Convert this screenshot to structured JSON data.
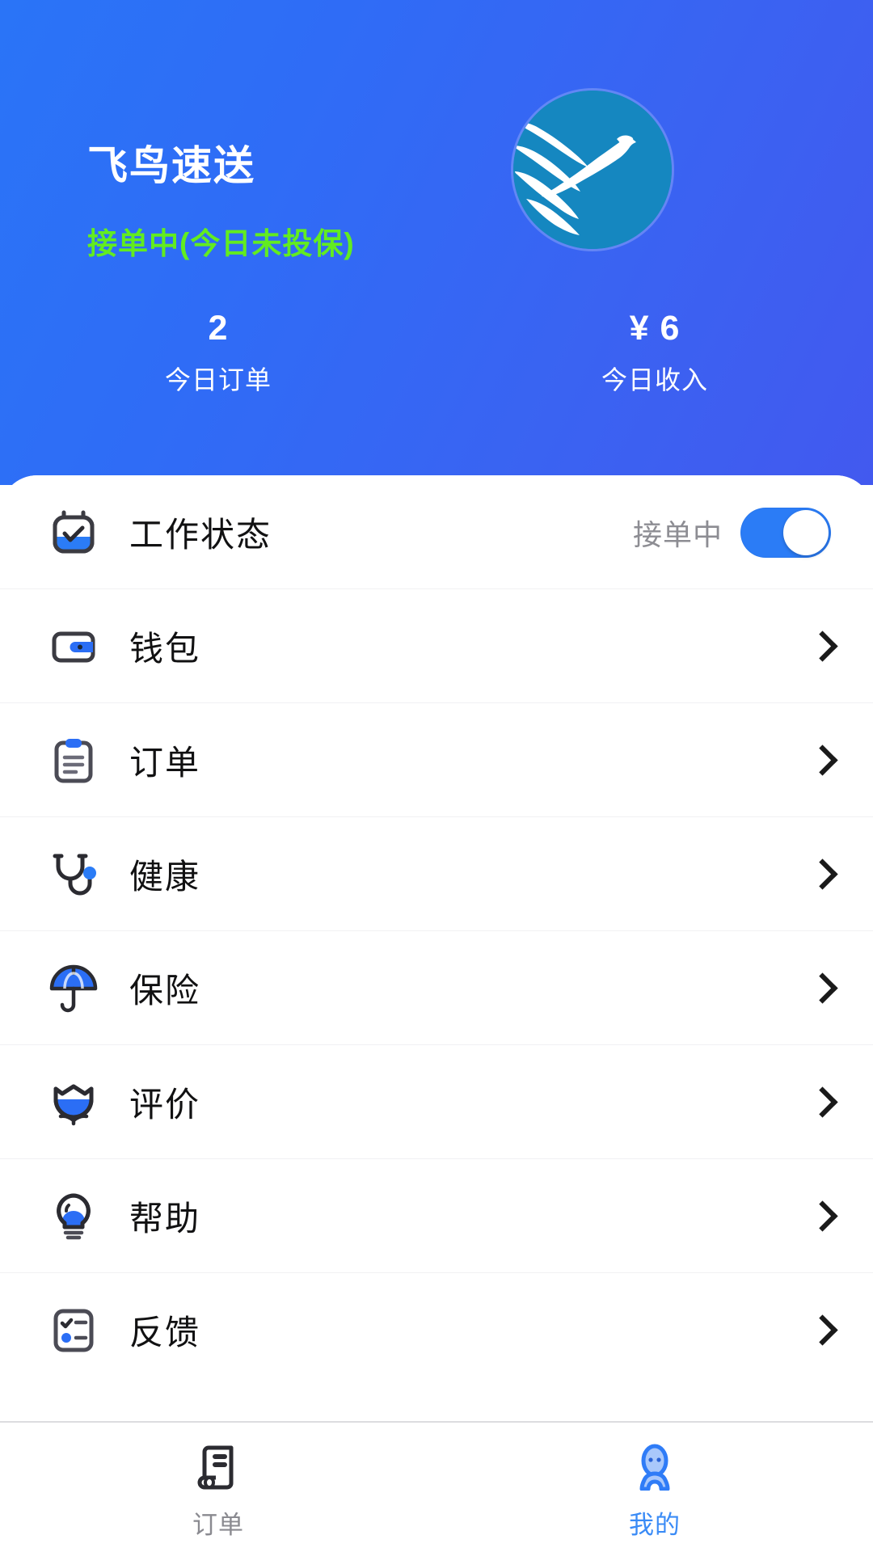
{
  "header": {
    "brand_title": "飞鸟速送",
    "brand_status": "接单中(今日未投保)",
    "logo_icon": "flying-bird-logo",
    "stats": [
      {
        "value": "2",
        "label": "今日订单"
      },
      {
        "value": "¥ 6",
        "label": "今日收入"
      }
    ]
  },
  "menu": {
    "rows": [
      {
        "icon": "calendar-check-icon",
        "label": "工作状态",
        "value": "接单中",
        "control": "toggle",
        "toggle_on": true
      },
      {
        "icon": "wallet-icon",
        "label": "钱包",
        "control": "chevron"
      },
      {
        "icon": "clipboard-icon",
        "label": "订单",
        "control": "chevron"
      },
      {
        "icon": "stethoscope-icon",
        "label": "健康",
        "control": "chevron"
      },
      {
        "icon": "umbrella-icon",
        "label": "保险",
        "control": "chevron"
      },
      {
        "icon": "flower-icon",
        "label": "评价",
        "control": "chevron"
      },
      {
        "icon": "lightbulb-icon",
        "label": "帮助",
        "control": "chevron"
      },
      {
        "icon": "checklist-icon",
        "label": "反馈",
        "control": "chevron"
      }
    ]
  },
  "tabbar": {
    "tabs": [
      {
        "icon": "receipt-icon",
        "label": "订单",
        "active": false
      },
      {
        "icon": "person-icon",
        "label": "我的",
        "active": true
      }
    ]
  },
  "colors": {
    "header_gradient_start": "#2a74f7",
    "header_gradient_end": "#4259ef",
    "status_green": "#62ec20",
    "accent_blue": "#2b7cf6",
    "logo_circle": "#1587c0",
    "tab_active": "#3a8bf6",
    "tab_inactive": "#8a8a90"
  }
}
